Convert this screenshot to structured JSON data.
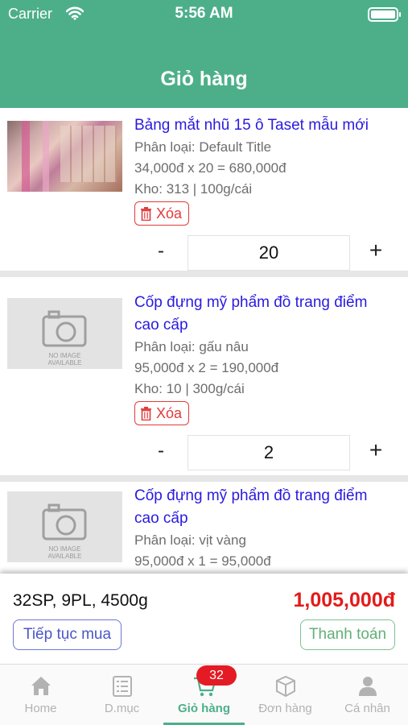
{
  "status_bar": {
    "carrier": "Carrier",
    "time": "5:56 AM"
  },
  "header": {
    "title": "Giỏ hàng"
  },
  "cart": {
    "items": [
      {
        "name": "Bảng mắt nhũ 15 ô Taset mẫu mới",
        "variant": "Phân loại: Default Title",
        "price_line": "34,000đ x 20 = 680,000đ",
        "stock_line": "Kho: 313 | 100g/cái",
        "delete_label": "Xóa",
        "quantity": "20",
        "minus": "-",
        "plus": "+"
      },
      {
        "name_line1": "Cốp đựng mỹ phẩm đồ trang điểm",
        "name_line2": "cao cấp",
        "variant": "Phân loại: gấu nâu",
        "price_line": "95,000đ x 2 = 190,000đ",
        "stock_line": "Kho: 10 | 300g/cái",
        "delete_label": "Xóa",
        "quantity": "2",
        "minus": "-",
        "plus": "+",
        "no_image_l1": "NO IMAGE",
        "no_image_l2": "AVAILABLE"
      },
      {
        "name_line1": "Cốp đựng mỹ phẩm đồ trang điểm",
        "name_line2": "cao cấp",
        "variant": "Phân loại: vịt vàng",
        "price_line": "95,000đ x 1 = 95,000đ",
        "no_image_l1": "NO IMAGE",
        "no_image_l2": "AVAILABLE"
      }
    ]
  },
  "summary": {
    "counts": "32SP, 9PL, 4500g",
    "total": "1,005,000đ",
    "continue_label": "Tiếp tục mua",
    "checkout_label": "Thanh toán"
  },
  "tabbar": {
    "tabs": [
      {
        "label": "Home",
        "icon": "home-icon"
      },
      {
        "label": "D.mục",
        "icon": "list-icon"
      },
      {
        "label": "Giỏ hàng",
        "icon": "cart-icon",
        "active": true,
        "badge": "32"
      },
      {
        "label": "Đơn hàng",
        "icon": "box-icon"
      },
      {
        "label": "Cá nhân",
        "icon": "person-icon"
      }
    ]
  },
  "colors": {
    "brand": "#4daf8a",
    "link": "#2a1ae0",
    "danger": "#e31a1a"
  }
}
